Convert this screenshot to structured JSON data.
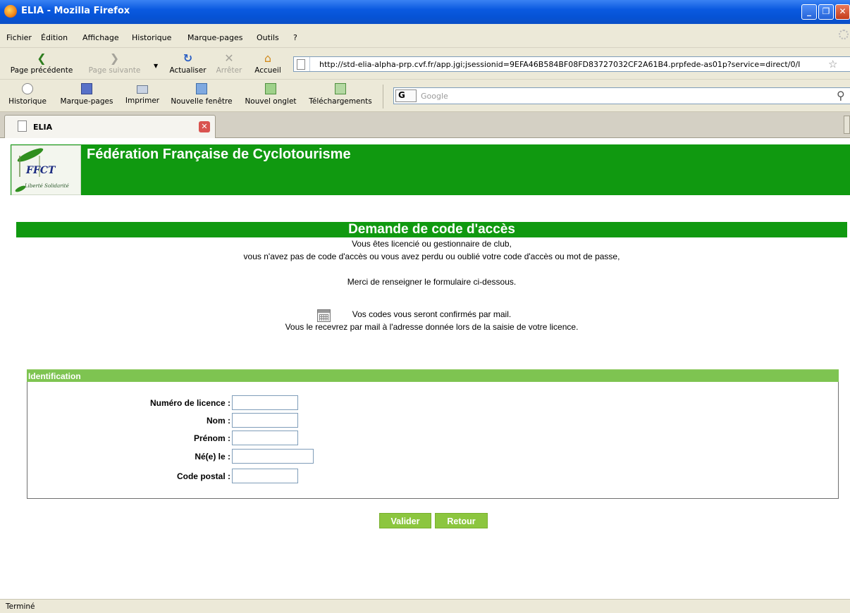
{
  "window": {
    "title": "ELIA - Mozilla Firefox"
  },
  "menu": {
    "items": [
      "Fichier",
      "Édition",
      "Affichage",
      "Historique",
      "Marque-pages",
      "Outils",
      "?"
    ]
  },
  "nav": {
    "back_label": "Page précédente",
    "forward_label": "Page suivante",
    "reload_label": "Actualiser",
    "stop_label": "Arrêter",
    "home_label": "Accueil",
    "url": "http://std-elia-alpha-prp.cvf.fr/app.jgi;jsessionid=9EFA46B584BF08FD83727032CF2A61B4.prpfede-as01p?service=direct/0/I"
  },
  "toolbar": {
    "history_label": "Historique",
    "bookmarks_label": "Marque-pages",
    "print_label": "Imprimer",
    "new_window_label": "Nouvelle fenêtre",
    "new_tab_label": "Nouvel onglet",
    "downloads_label": "Téléchargements",
    "search_engine": "G",
    "search_placeholder": "Google"
  },
  "tabs": [
    {
      "label": "ELIA"
    }
  ],
  "page": {
    "logo_text": "FFCT",
    "logo_subtext": "Liberté Solidarité",
    "site_title": "Fédération Française de Cyclotourisme",
    "section_title": "Demande de code d'accès",
    "intro_lines": [
      "Vous êtes licencié ou gestionnaire de club,",
      "vous n'avez pas de code d'accès ou vous avez perdu ou oublié votre code d'accès ou mot de passe,",
      "Merci de renseigner le formulaire ci-dessous.",
      "Vos codes vous seront confirmés par mail.",
      "Vous le recevrez par mail à l'adresse donnée lors de la saisie de votre licence."
    ],
    "form": {
      "header": "Identification",
      "fields": {
        "licence_label": "Numéro de licence :",
        "licence_value": "",
        "nom_label": "Nom :",
        "nom_value": "",
        "prenom_label": "Prénom :",
        "prenom_value": "",
        "birth_label": "Né(e) le :",
        "birth_value": "",
        "postal_label": "Code postal :",
        "postal_value": ""
      }
    },
    "buttons": {
      "validate_label": "Valider",
      "back_label": "Retour"
    }
  },
  "status": {
    "text": "Terminé"
  },
  "colors": {
    "brand_green": "#109910",
    "form_header_green": "#7ec451",
    "button_green": "#8cc63f",
    "titlebar_blue": "#0a5ae0"
  }
}
